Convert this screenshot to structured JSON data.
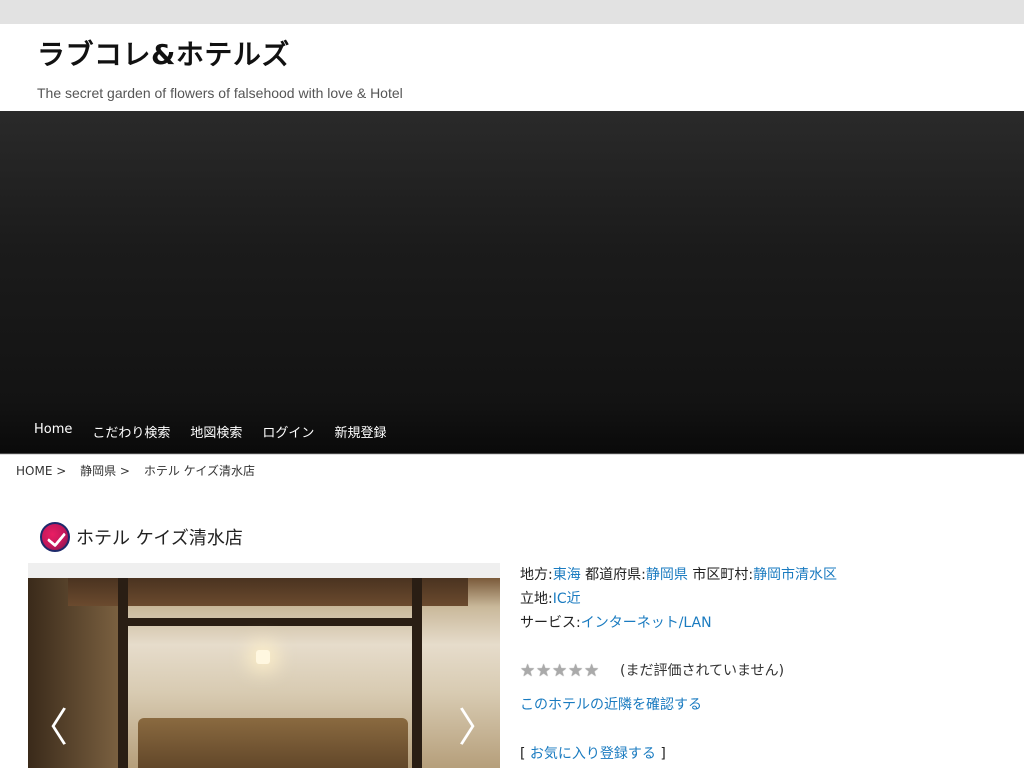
{
  "site": {
    "title": "ラブコレ&ホテルズ",
    "description": "The secret garden of flowers of falsehood with love & Hotel"
  },
  "nav": {
    "items": [
      "Home",
      "こだわり検索",
      "地図検索",
      "ログイン",
      "新規登録"
    ]
  },
  "breadcrumb": {
    "items": [
      "HOME >",
      "静岡県 >",
      "ホテル ケイズ清水店"
    ]
  },
  "hotel": {
    "name": "ホテル ケイズ清水店",
    "region_label": "地方:",
    "region_value": "東海",
    "prefecture_label": "都道府県:",
    "prefecture_value": "静岡県",
    "city_label": "市区町村:",
    "city_value": "静岡市清水区",
    "location_label": "立地:",
    "location_value": "IC近",
    "service_label": "サービス:",
    "service_value": "インターネット/LAN",
    "rating_value": 0,
    "rating_max": 5,
    "rating_text": "(まだ評価されていません)",
    "nearby_link": "このホテルの近隣を確認する",
    "favorite_open": "[",
    "favorite_link": "お気に入り登録する",
    "favorite_close": "]"
  },
  "slider": {
    "prev_label": "〈",
    "next_label": "〉"
  },
  "icons": {
    "title_icon": "check-badge-icon",
    "star_icon": "star-icon"
  },
  "colors": {
    "link": "#1a7bc0",
    "banner": "#1b1b1b",
    "topbar": "#e2e2e2"
  }
}
